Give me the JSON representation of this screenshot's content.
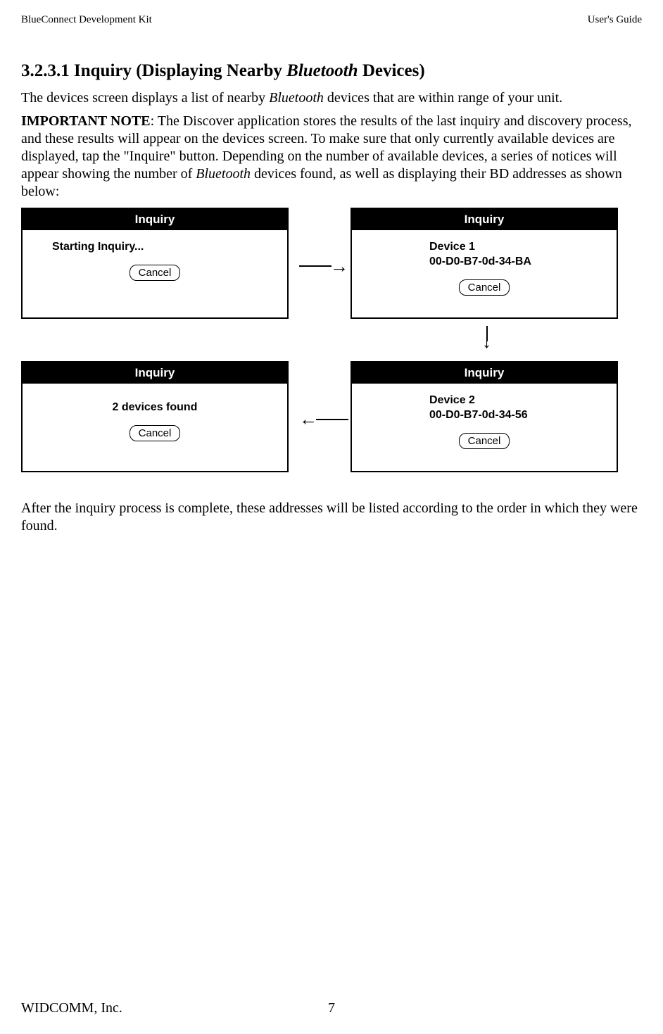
{
  "header": {
    "left": "BlueConnect Development Kit",
    "right": "User's Guide"
  },
  "section": {
    "number": "3.2.3.1",
    "title_before_italic": " Inquiry (Displaying Nearby ",
    "italic_word": "Bluetooth",
    "title_after_italic": " Devices)"
  },
  "paragraph1": {
    "before_italic": "The devices screen displays a list of nearby ",
    "italic": "Bluetooth",
    "after_italic": " devices that are within range of your unit."
  },
  "paragraph2": {
    "bold_label": "IMPORTANT NOTE",
    "text_before_italic": ":  The Discover application stores the results of the last inquiry and discovery process, and these results will appear on the devices screen.  To make sure that only currently available devices are displayed, tap the \"Inquire\" button.  Depending on the number of available devices, a series of notices will appear showing the number of ",
    "italic": "Bluetooth",
    "text_after_italic": " devices found, as well as displaying their BD addresses as shown below:"
  },
  "screens": {
    "titlebar": "Inquiry",
    "cancel_label": "Cancel",
    "screen1_text": "Starting Inquiry...",
    "screen2_line1": "Device 1",
    "screen2_line2": "00-D0-B7-0d-34-BA",
    "screen3_line1": "Device 2",
    "screen3_line2": "00-D0-B7-0d-34-56",
    "screen4_text": "2 devices found"
  },
  "paragraph3": "After the inquiry process is complete, these addresses will be listed according to the order in which they were found.",
  "footer": {
    "company": "WIDCOMM, Inc.",
    "page": "7"
  }
}
